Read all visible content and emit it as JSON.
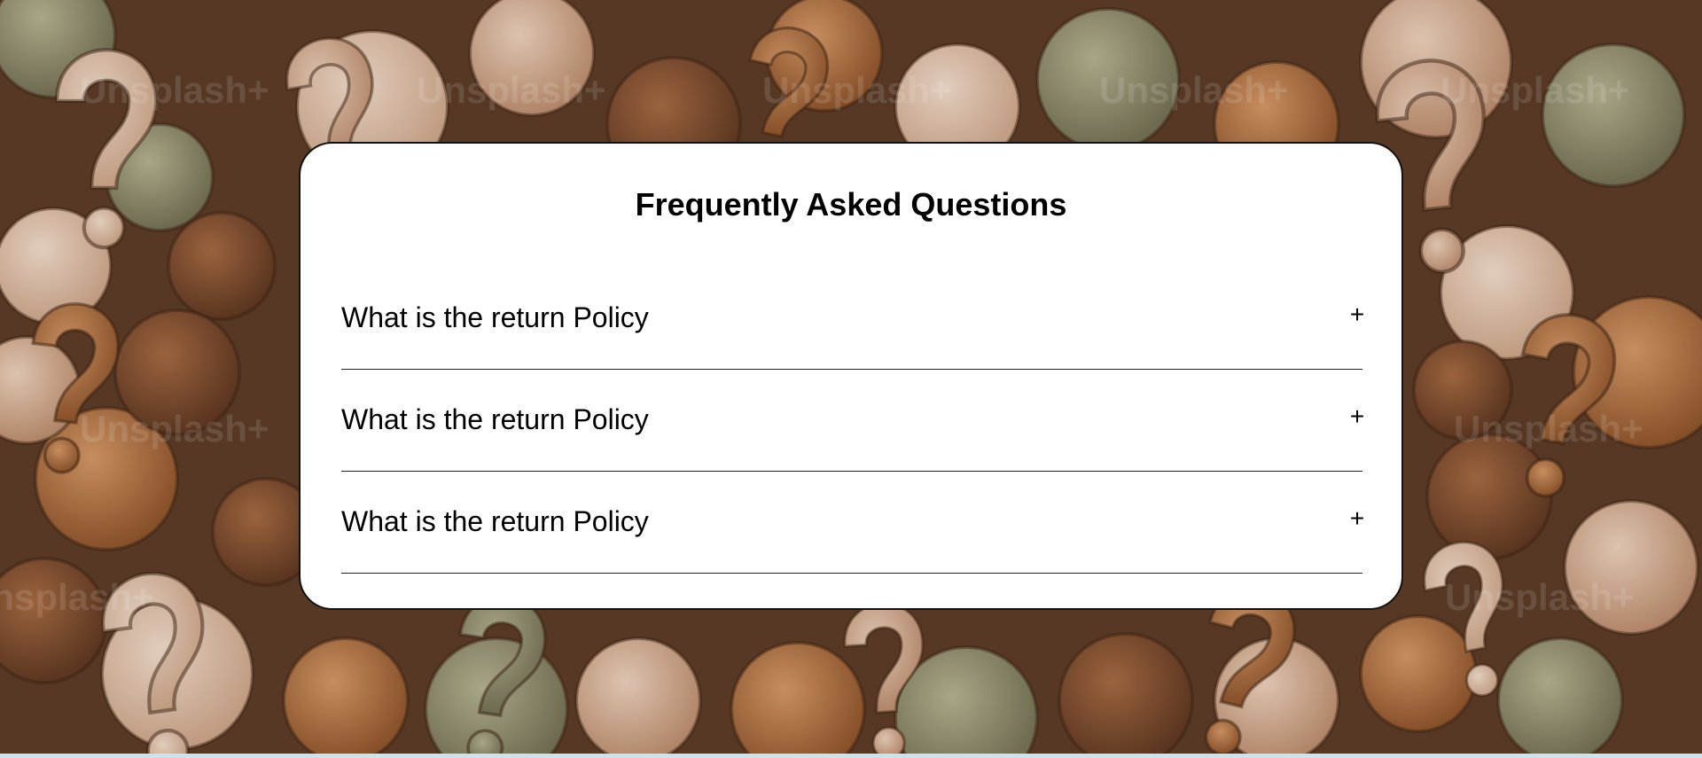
{
  "faq": {
    "title": "Frequently Asked Questions",
    "items": [
      {
        "question": "What is the return Policy",
        "toggle": "+"
      },
      {
        "question": "What is the return Policy",
        "toggle": "+"
      },
      {
        "question": "What is the return Policy",
        "toggle": "+"
      }
    ]
  },
  "background": {
    "watermark_text": "Unsplash+",
    "theme": "question-marks-pattern",
    "colors": {
      "tan_light": "#d9b89c",
      "tan": "#c99a74",
      "caramel": "#a8693a",
      "brown": "#7a4a2a",
      "olive": "#8e8c6c",
      "dark": "#3a2a1e"
    }
  }
}
